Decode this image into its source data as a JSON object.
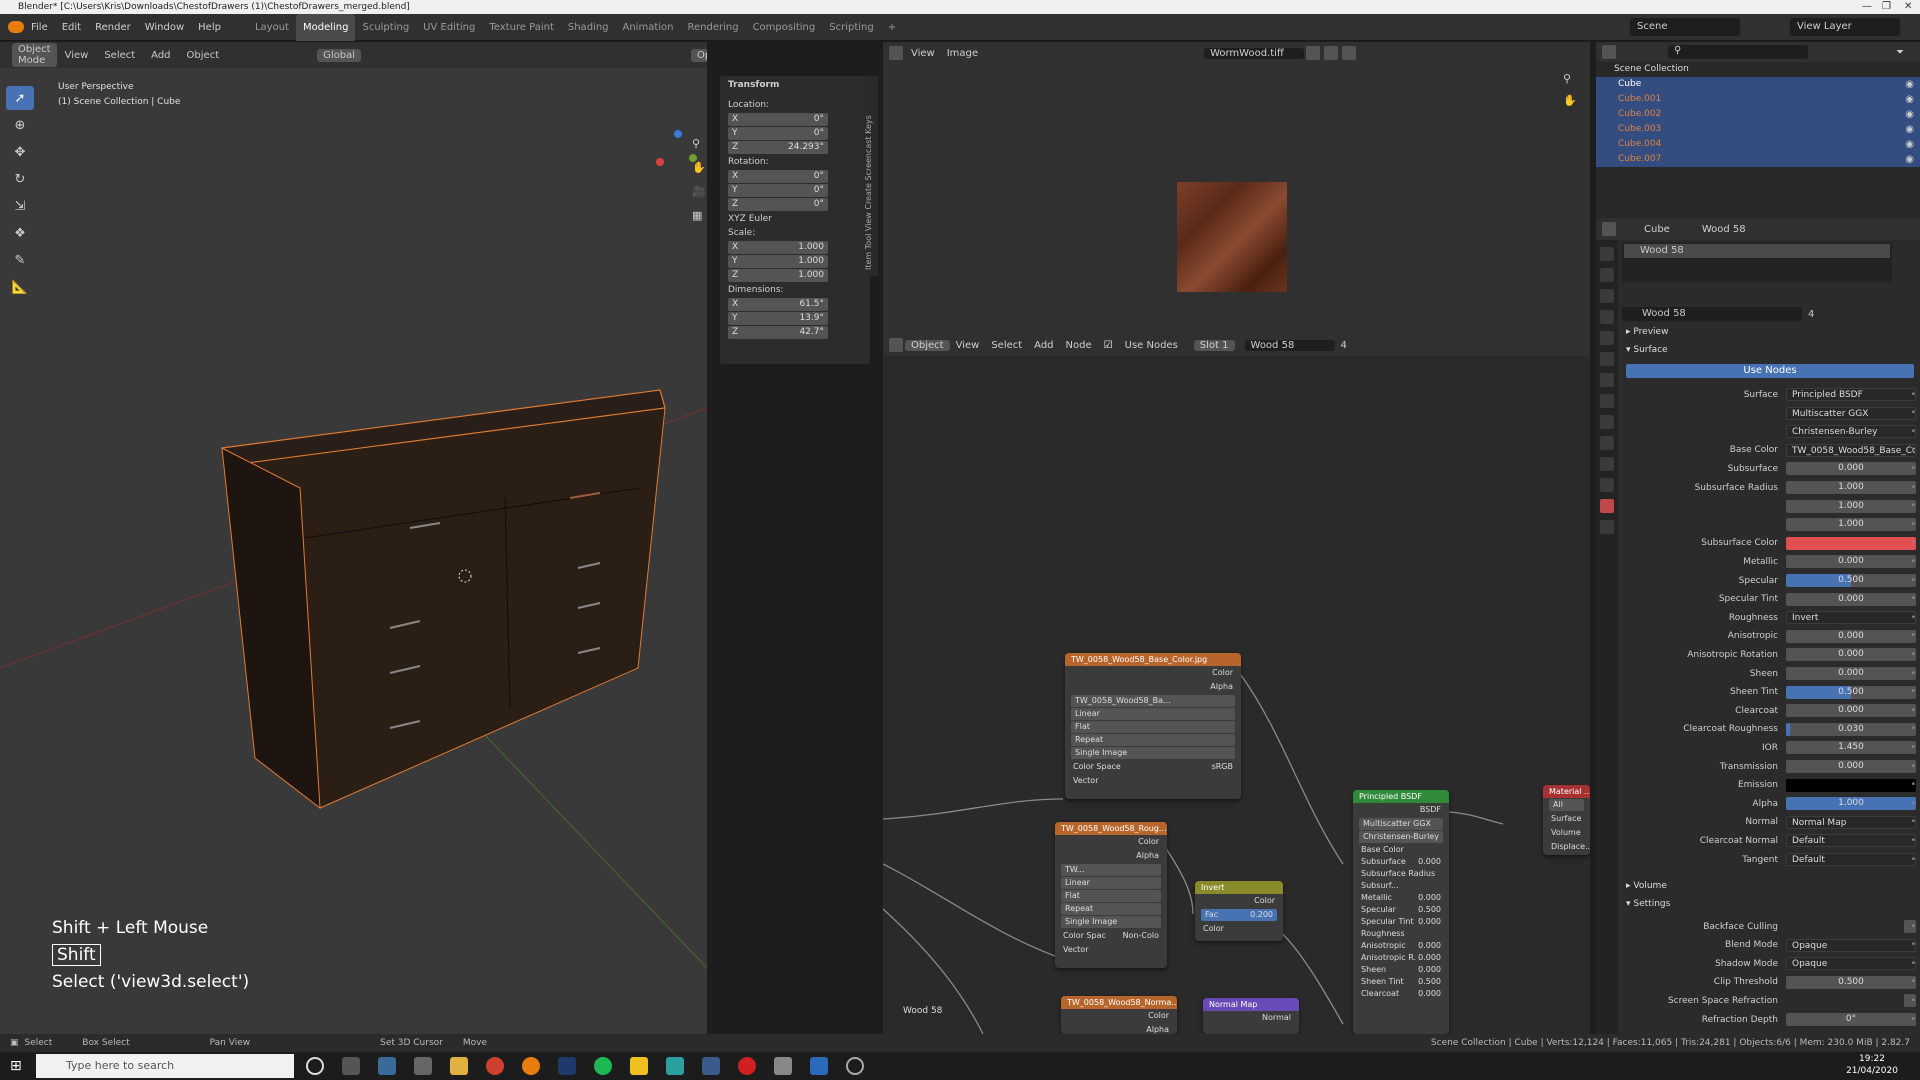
{
  "window": {
    "title": "Blender* [C:\\Users\\Kris\\Downloads\\ChestofDrawers (1)\\ChestofDrawers_merged.blend]"
  },
  "menu": [
    "File",
    "Edit",
    "Render",
    "Window",
    "Help"
  ],
  "workspaces": [
    "Layout",
    "Modeling",
    "Sculpting",
    "UV Editing",
    "Texture Paint",
    "Shading",
    "Animation",
    "Rendering",
    "Compositing",
    "Scripting"
  ],
  "active_workspace": "Modeling",
  "topbar_right": {
    "scene": "Scene",
    "view_layer": "View Layer"
  },
  "viewport": {
    "mode": "Object Mode",
    "menu": [
      "View",
      "Select",
      "Add",
      "Object"
    ],
    "transform_orientation": "Global",
    "options_label": "Options",
    "overlay_title": "User Perspective",
    "overlay_sub": "(1) Scene Collection | Cube"
  },
  "npanel": {
    "section": "Transform",
    "location_label": "Location:",
    "location": {
      "x": "0°",
      "y": "0°",
      "z": "24.293°"
    },
    "rotation_label": "Rotation:",
    "rotation": {
      "x": "0°",
      "y": "0°",
      "z": "0°"
    },
    "rotation_mode": "XYZ Euler",
    "scale_label": "Scale:",
    "scale": {
      "x": "1.000",
      "y": "1.000",
      "z": "1.000"
    },
    "dimensions_label": "Dimensions:",
    "dimensions": {
      "x": "61.5°",
      "y": "13.9°",
      "z": "42.7°"
    },
    "tabs": "Item  Tool  View  Create  Screencast Keys"
  },
  "keyhud": {
    "combo": "Shift + Left Mouse",
    "key": "Shift",
    "op": "Select ('view3d.select')"
  },
  "image_editor": {
    "menu": [
      "View",
      "Image"
    ],
    "image_name": "WormWood.tiff"
  },
  "node_editor": {
    "mode": "Object",
    "menu": [
      "View",
      "Select",
      "Add",
      "Node"
    ],
    "use_nodes": "Use Nodes",
    "slot": "Slot 1",
    "material": "Wood 58",
    "users": "4",
    "footer_label": "Wood 58",
    "nodes": {
      "base": {
        "title": "TW_0058_Wood58_Base_Color.jpg",
        "out1": "Color",
        "out2": "Alpha",
        "img": "TW_0058_Wood58_Ba...",
        "interp": "Linear",
        "proj": "Flat",
        "ext": "Repeat",
        "src": "Single Image",
        "cs_label": "Color Space",
        "cs": "sRGB",
        "vec": "Vector"
      },
      "rough": {
        "title": "TW_0058_Wood58_Roug...",
        "out1": "Color",
        "out2": "Alpha",
        "img": "TW...",
        "interp": "Linear",
        "proj": "Flat",
        "ext": "Repeat",
        "src": "Single Image",
        "cs_label": "Color Spac",
        "cs": "Non-Colo",
        "vec": "Vector"
      },
      "normal_img": {
        "title": "TW_0058_Wood58_Norma...",
        "out1": "Color",
        "out2": "Alpha"
      },
      "invert": {
        "title": "Invert",
        "out": "Color",
        "fac_label": "Fac",
        "fac": "0.200",
        "in": "Color"
      },
      "normalmap": {
        "title": "Normal Map",
        "out": "Normal"
      },
      "bsdf": {
        "title": "Principled BSDF",
        "out": "BSDF",
        "dist": "Multiscatter GGX",
        "ss": "Christensen-Burley",
        "rows": [
          [
            "Base Color",
            ""
          ],
          [
            "Subsurface",
            "0.000"
          ],
          [
            "Subsurface Radius",
            ""
          ],
          [
            "Subsurf...",
            ""
          ],
          [
            "Metallic",
            "0.000"
          ],
          [
            "Specular",
            "0.500"
          ],
          [
            "Specular Tint",
            "0.000"
          ],
          [
            "Roughness",
            ""
          ],
          [
            "Anisotropic",
            "0.000"
          ],
          [
            "Anisotropic R.",
            "0.000"
          ],
          [
            "Sheen",
            "0.000"
          ],
          [
            "Sheen Tint",
            "0.500"
          ],
          [
            "Clearcoat",
            "0.000"
          ]
        ]
      },
      "output": {
        "title": "Material ...",
        "target": "All",
        "in": [
          "Surface",
          "Volume",
          "Displace..."
        ]
      }
    }
  },
  "outliner": {
    "root": "Scene Collection",
    "items": [
      "Cube",
      "Cube.001",
      "Cube.002",
      "Cube.003",
      "Cube.004",
      "Cube.007"
    ]
  },
  "properties": {
    "object": "Cube",
    "material": "Wood 58",
    "slot_item": "Wood 58",
    "mat_field": "Wood 58",
    "mat_users": "4",
    "sections": {
      "preview": "Preview",
      "surface": "Surface",
      "volume": "Volume",
      "settings": "Settings"
    },
    "use_nodes": "Use Nodes",
    "rows": [
      {
        "label": "Surface",
        "value": "Principled BSDF",
        "kind": "dd"
      },
      {
        "label": "",
        "value": "Multiscatter GGX",
        "kind": "dd"
      },
      {
        "label": "",
        "value": "Christensen-Burley",
        "kind": "dd"
      },
      {
        "label": "Base Color",
        "value": "TW_0058_Wood58_Base_Colo...",
        "kind": "dd"
      },
      {
        "label": "Subsurface",
        "value": "0.000",
        "kind": "num"
      },
      {
        "label": "Subsurface Radius",
        "value": "1.000",
        "kind": "num"
      },
      {
        "label": "",
        "value": "1.000",
        "kind": "num"
      },
      {
        "label": "",
        "value": "1.000",
        "kind": "num"
      },
      {
        "label": "Subsurface Color",
        "value": "",
        "kind": "red"
      },
      {
        "label": "Metallic",
        "value": "0.000",
        "kind": "num"
      },
      {
        "label": "Specular",
        "value": "0.500",
        "kind": "bar",
        "fill": 0.5
      },
      {
        "label": "Specular Tint",
        "value": "0.000",
        "kind": "num"
      },
      {
        "label": "Roughness",
        "value": "Invert",
        "kind": "dd"
      },
      {
        "label": "Anisotropic",
        "value": "0.000",
        "kind": "num"
      },
      {
        "label": "Anisotropic Rotation",
        "value": "0.000",
        "kind": "num"
      },
      {
        "label": "Sheen",
        "value": "0.000",
        "kind": "num"
      },
      {
        "label": "Sheen Tint",
        "value": "0.500",
        "kind": "bar",
        "fill": 0.5
      },
      {
        "label": "Clearcoat",
        "value": "0.000",
        "kind": "num"
      },
      {
        "label": "Clearcoat Roughness",
        "value": "0.030",
        "kind": "bar",
        "fill": 0.03
      },
      {
        "label": "IOR",
        "value": "1.450",
        "kind": "num"
      },
      {
        "label": "Transmission",
        "value": "0.000",
        "kind": "num"
      },
      {
        "label": "Emission",
        "value": "",
        "kind": "black"
      },
      {
        "label": "Alpha",
        "value": "1.000",
        "kind": "bar",
        "fill": 1.0
      },
      {
        "label": "Normal",
        "value": "Normal Map",
        "kind": "dd"
      },
      {
        "label": "Clearcoat Normal",
        "value": "Default",
        "kind": "dd"
      },
      {
        "label": "Tangent",
        "value": "Default",
        "kind": "dd"
      }
    ],
    "settings": [
      {
        "label": "Backface Culling",
        "value": "",
        "kind": "check"
      },
      {
        "label": "Blend Mode",
        "value": "Opaque",
        "kind": "dd"
      },
      {
        "label": "Shadow Mode",
        "value": "Opaque",
        "kind": "dd"
      },
      {
        "label": "Clip Threshold",
        "value": "0.500",
        "kind": "num"
      },
      {
        "label": "Screen Space Refraction",
        "value": "",
        "kind": "check"
      },
      {
        "label": "Refraction Depth",
        "value": "0°",
        "kind": "num"
      }
    ]
  },
  "statusbar": {
    "select": "Select",
    "box_select": "Box Select",
    "pan_view": "Pan View",
    "set_cursor": "Set 3D Cursor",
    "move": "Move",
    "stats": "Scene Collection | Cube | Verts:12,124 | Faces:11,065 | Tris:24,281 | Objects:6/6 | Mem: 230.0 MiB | 2.82.7"
  },
  "taskbar": {
    "search_placeholder": "Type here to search",
    "time": "19:22",
    "date": "21/04/2020"
  },
  "colors": {
    "accent": "#4772b3",
    "selection_outline": "#e07a30",
    "texture_node": "#b8652b",
    "shader_node": "#2f8a3a",
    "invert_node": "#8a8a2a",
    "vector_node": "#6a4ab8",
    "output_node": "#a83232"
  }
}
